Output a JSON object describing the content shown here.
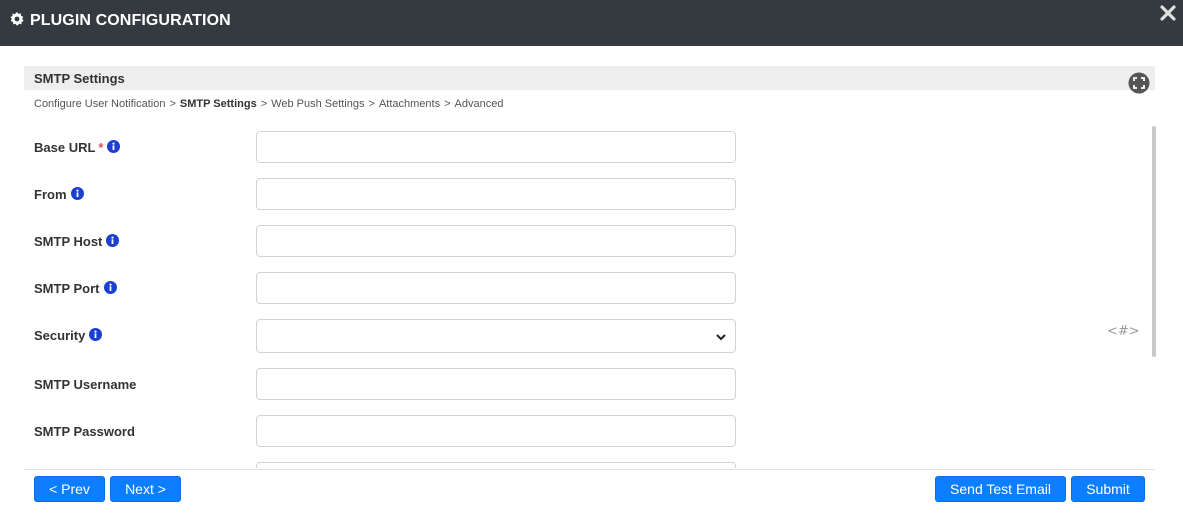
{
  "dialog": {
    "title": "PLUGIN CONFIGURATION",
    "icons": {
      "title_icon": "gear-icon",
      "close_icon": "close-icon"
    }
  },
  "section": {
    "title": "SMTP Settings",
    "expand_icon": "fullscreen-icon"
  },
  "breadcrumb": {
    "items": [
      {
        "label": "Configure User Notification",
        "current": false
      },
      {
        "label": "SMTP Settings",
        "current": true
      },
      {
        "label": "Web Push Settings",
        "current": false
      },
      {
        "label": "Attachments",
        "current": false
      },
      {
        "label": "Advanced",
        "current": false
      }
    ],
    "separator": ">"
  },
  "form": {
    "fields": [
      {
        "label": "Base URL",
        "required": true,
        "required_mark": "*",
        "info": true,
        "type": "text",
        "value": ""
      },
      {
        "label": "From",
        "required": false,
        "info": true,
        "type": "text",
        "value": ""
      },
      {
        "label": "SMTP Host",
        "required": false,
        "info": true,
        "type": "text",
        "value": ""
      },
      {
        "label": "SMTP Port",
        "required": false,
        "info": true,
        "type": "text",
        "value": ""
      },
      {
        "label": "Security",
        "required": false,
        "info": true,
        "type": "select",
        "value": ""
      },
      {
        "label": "SMTP Username",
        "required": false,
        "info": false,
        "type": "text",
        "value": ""
      },
      {
        "label": "SMTP Password",
        "required": false,
        "info": false,
        "type": "password",
        "value": ""
      }
    ]
  },
  "side_icon": {
    "label": "<#>",
    "icon": "code-hash-icon"
  },
  "footer": {
    "prev_label": "< Prev",
    "next_label": "Next >",
    "test_email_label": "Send Test Email",
    "submit_label": "Submit"
  },
  "colors": {
    "titlebar_bg": "#343a40",
    "primary_button": "#0d7eff",
    "info_icon": "#1a3fd1",
    "required_mark": "#d9534f"
  }
}
